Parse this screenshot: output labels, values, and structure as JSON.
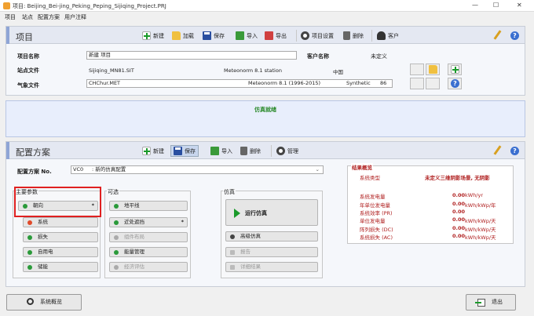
{
  "window": {
    "title": "项目: Beijing_Bei-jing_Peking_Peping_Sijiqing_Project.PRJ",
    "min": "—",
    "max": "☐",
    "close": "✕"
  },
  "menu": [
    "项目",
    "站点",
    "配置方案",
    "用户注释"
  ],
  "project": {
    "header": "项目",
    "toolbar": {
      "new": "新建",
      "load": "加载",
      "save": "保存",
      "import": "导入",
      "export": "导出",
      "settings": "项目设置",
      "delete": "删除",
      "client": "客户"
    },
    "name_label": "项目名称",
    "name_value": "新建 项目",
    "client_label": "客户名称",
    "client_value": "未定义",
    "site_label": "站点文件",
    "site_file": "Sijiqing_MN81.SIT",
    "site_source": "Meteonorm 8.1 station",
    "site_country": "中国",
    "meteo_label": "气象文件",
    "meteo_file": "CHChur.MET",
    "meteo_source": "Meteonorm 8.1 (1996-2015)",
    "meteo_type": "Synthetic",
    "meteo_num": "86"
  },
  "status": {
    "message": "仿真就绪"
  },
  "variant": {
    "header": "配置方案",
    "toolbar": {
      "new": "新建",
      "save": "保存",
      "import": "导入",
      "delete": "删除",
      "manage": "管理"
    },
    "no_label": "配置方案 No.",
    "no_value": "VC0",
    "no_desc": ": 新的仿真配置",
    "main_title": "主要参数",
    "optional_title": "可选",
    "sim_title": "仿真",
    "main_buttons": [
      "朝向",
      "系统",
      "损失",
      "自用电",
      "储能"
    ],
    "orientation_mark": "*",
    "optional_buttons": [
      "地平线",
      "近处遮挡",
      "组件布局",
      "能量管理",
      "经济评估"
    ],
    "near_shading_mark": "*",
    "sim_buttons": {
      "run": "运行仿真",
      "advanced": "高级仿真",
      "report": "报告",
      "detailed": "详细结果"
    }
  },
  "results": {
    "title": "结果概览",
    "system_type_label": "系统类型",
    "system_type_value": "未定义三维阴影场景, 无阴影",
    "rows": [
      {
        "label": "系统发电量",
        "value": "0.00",
        "unit": "kWh/yr"
      },
      {
        "label": "年单位发电量",
        "value": "0.00",
        "unit": "kWh/kWp/年"
      },
      {
        "label": "系统效率 (PR)",
        "value": "0.00",
        "unit": ""
      },
      {
        "label": "单位发电量",
        "value": "0.00",
        "unit": "kWh/kWp/天"
      },
      {
        "label": "阵列损失 (DC)",
        "value": "0.00",
        "unit": "kWh/kWp/天"
      },
      {
        "label": "系统损失 (AC)",
        "value": "0.00",
        "unit": "kWh/kWp/天"
      }
    ]
  },
  "bottom": {
    "overview": "系统概览",
    "exit": "退出"
  },
  "colors": {
    "accent_green": "#2a8a2a",
    "result_red": "#b02020",
    "highlight_red": "#e02020"
  }
}
